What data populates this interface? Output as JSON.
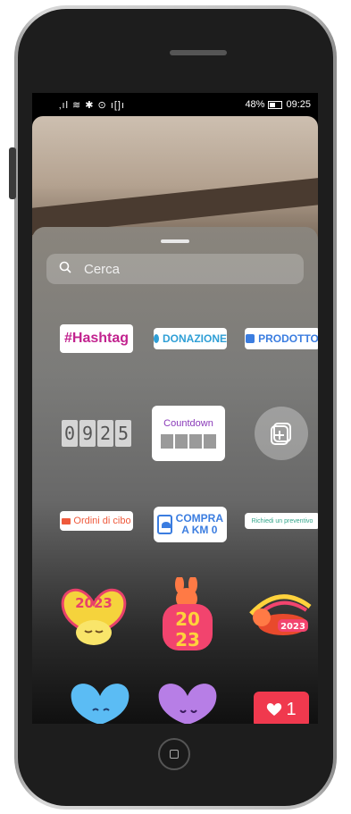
{
  "status_bar": {
    "left_icons": "‚ıl ≋ ✱ ⊙ ı[]ı",
    "battery": "48%",
    "time": "09:25"
  },
  "search": {
    "placeholder": "Cerca",
    "value": ""
  },
  "stickers": {
    "hashtag": "#Hashtag",
    "donazione": "DONAZIONE",
    "prodotto": "PRODOTTO",
    "timer_digits": [
      "0",
      "9",
      "2",
      "5"
    ],
    "countdown": "Countdown",
    "ordini": "Ordini di cibo",
    "compra_line1": "COMPRA",
    "compra_line2": "A KM 0",
    "preventivo": "Richiedi un preventivo",
    "year": "2023",
    "like_count": "1"
  },
  "icons": {
    "search": "search-icon",
    "add_sticker": "add-photo-sticker-icon",
    "heart": "heart-icon",
    "home": "home-button-icon"
  },
  "colors": {
    "hashtag": "#c2238f",
    "donazione": "#2f9fd6",
    "prodotto": "#3b7de0",
    "countdown": "#8a3ab9",
    "ordini": "#ef5a3c",
    "preventivo": "#33a58a",
    "like": "#f0394e"
  }
}
